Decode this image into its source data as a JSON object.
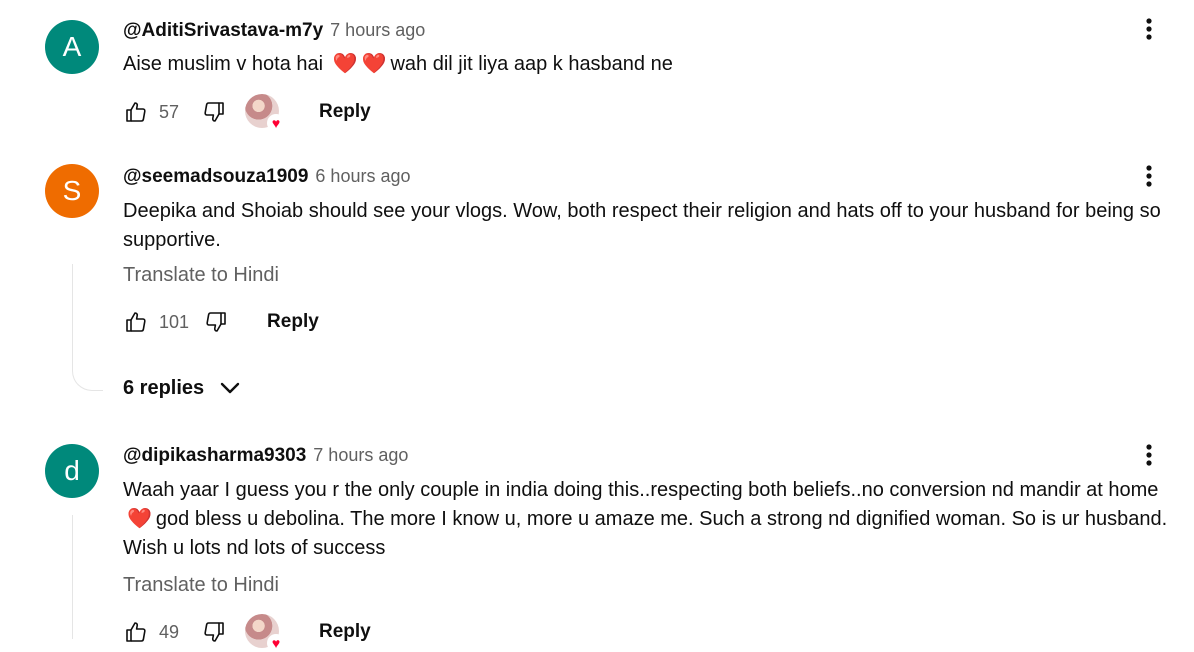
{
  "comments": [
    {
      "avatar_letter": "A",
      "avatar_color": "#00897b",
      "author": "@AditiSrivastava-m7y",
      "time": "7 hours ago",
      "text_before": "Aise muslim v hota hai",
      "text_after": "wah dil jit liya aap k hasband ne",
      "likes": "57",
      "reply_label": "Reply"
    },
    {
      "avatar_letter": "S",
      "avatar_color": "#ef6c00",
      "author": "@seemadsouza1909",
      "time": "6 hours ago",
      "text": "Deepika and Shoiab should see your vlogs. Wow, both respect their religion and hats off to your husband for being so supportive.",
      "translate": "Translate to Hindi",
      "likes": "101",
      "reply_label": "Reply",
      "replies_label": "6 replies"
    },
    {
      "avatar_letter": "d",
      "avatar_color": "#00897b",
      "author": "@dipikasharma9303",
      "time": "7 hours ago",
      "text_before": "Waah yaar I guess you r the only couple in india doing this..respecting both beliefs..no conversion nd mandir at home",
      "text_after": "god bless u debolina. The more I know u, more u amaze me. Such a strong nd dignified woman. So is ur husband. Wish u lots nd lots of success",
      "translate": "Translate to Hindi",
      "likes": "49",
      "reply_label": "Reply"
    }
  ],
  "icons": {
    "like": "thumbs-up-icon",
    "dislike": "thumbs-down-icon",
    "more": "more-vertical-icon",
    "heart": "heart-emoji",
    "chevron": "chevron-down-icon"
  },
  "colors": {
    "heart_emoji": "#e0245e",
    "creator_heart": "#ff0033",
    "secondary_text": "#606060"
  }
}
